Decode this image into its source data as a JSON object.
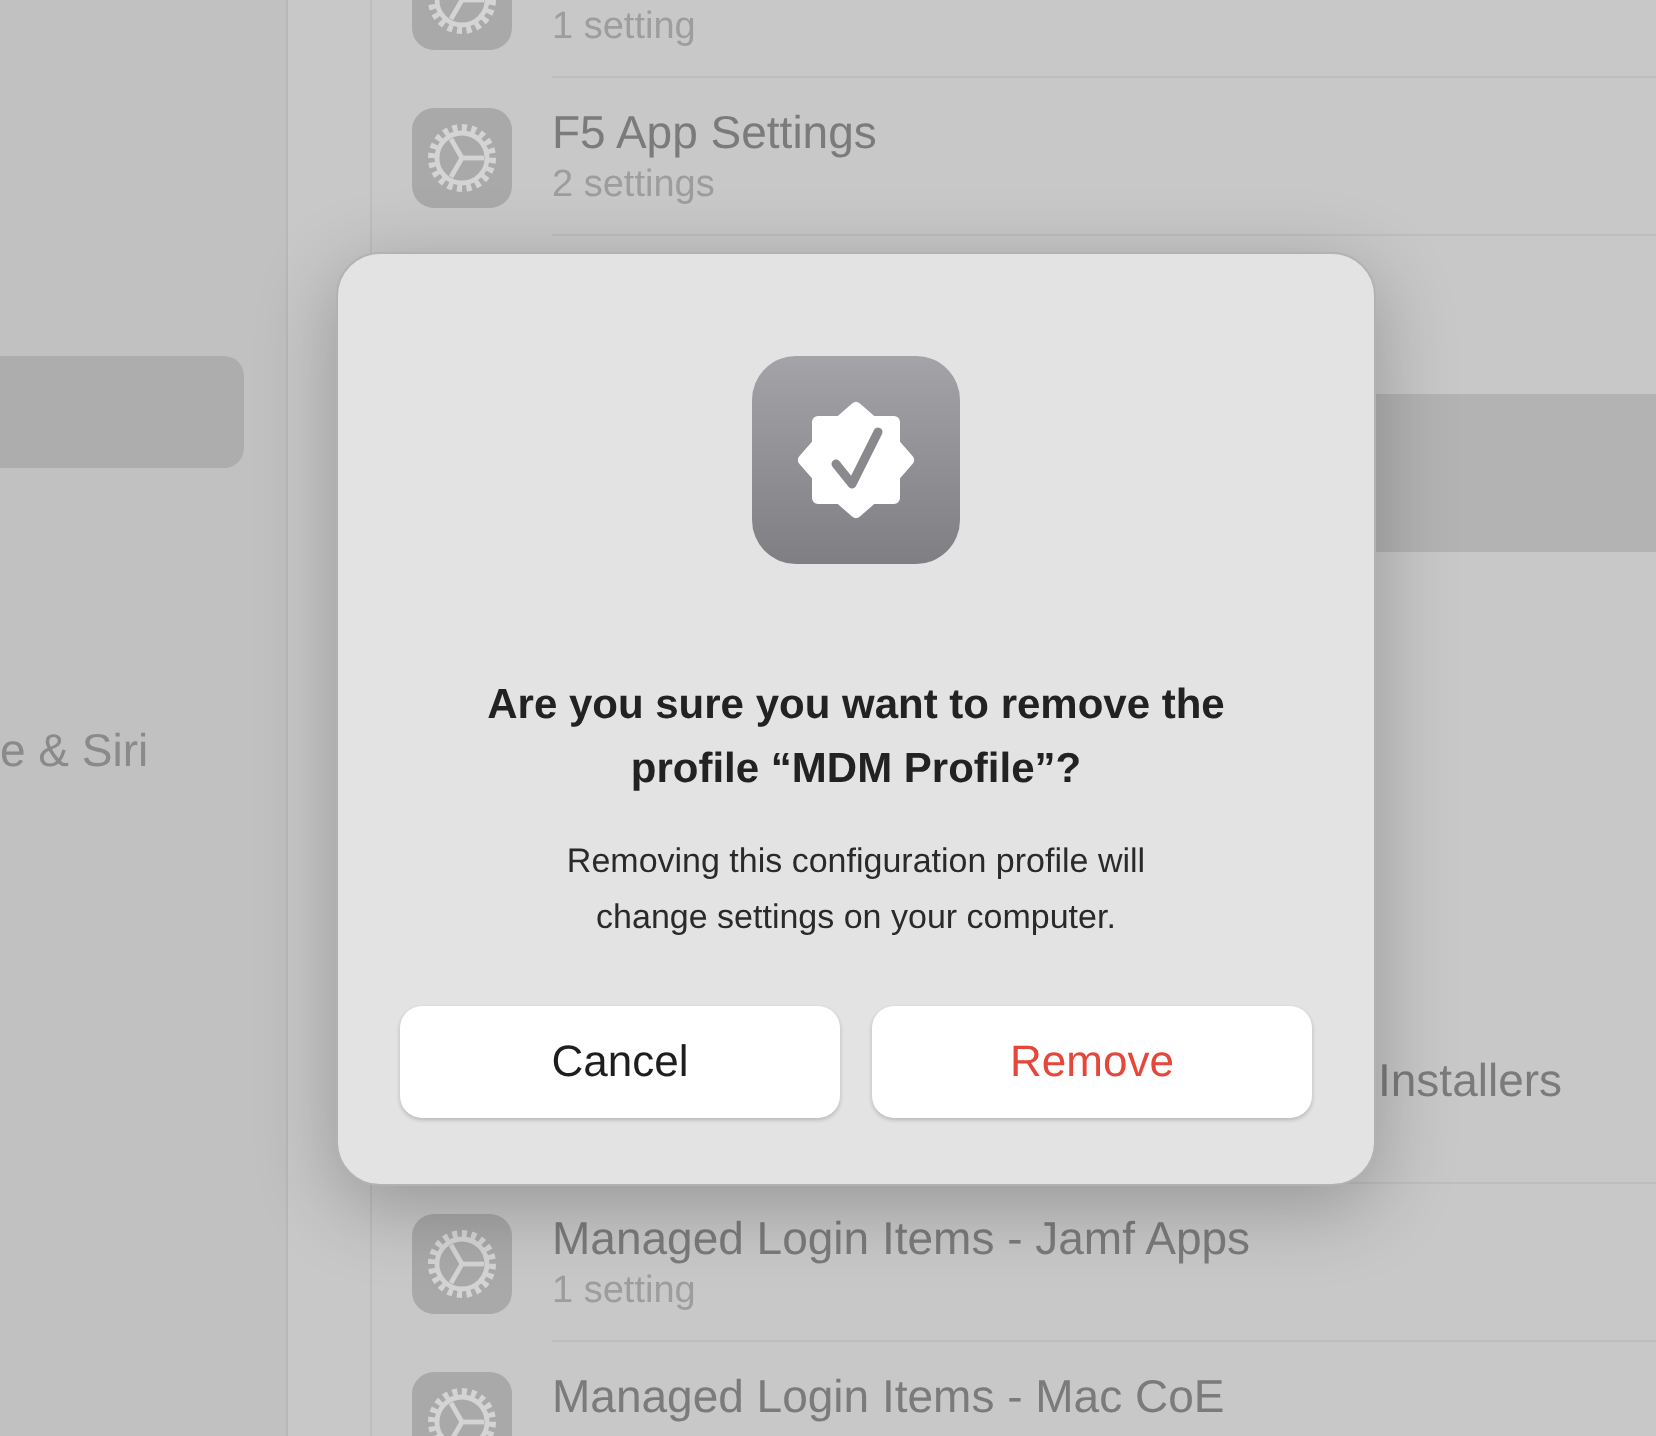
{
  "sidebar": {
    "items": [
      {
        "selected": true
      },
      {
        "label": "e & Siri",
        "selected": false
      }
    ]
  },
  "profiles": [
    {
      "subtitle": "1 setting",
      "selected": false,
      "kind": "plain"
    },
    {
      "title": "F5 App Settings",
      "subtitle": "2 settings",
      "selected": false,
      "kind": "plain"
    },
    {
      "selected": false,
      "kind": "covered"
    },
    {
      "selected": true,
      "kind": "covered"
    },
    {
      "selected": false,
      "kind": "covered"
    },
    {
      "selected": false,
      "kind": "covered"
    },
    {
      "selected": false,
      "kind": "covered"
    },
    {
      "title": "Installers",
      "selected": false,
      "kind": "partly_covered"
    },
    {
      "title": "Managed Login Items - Jamf Apps",
      "subtitle": "1 setting",
      "selected": false,
      "kind": "plain"
    },
    {
      "title": "Managed Login Items - Mac CoE",
      "selected": false,
      "kind": "plain"
    }
  ],
  "dialog": {
    "title": "Are you sure you want to remove the profile “MDM Profile”?",
    "message": "Removing this configuration profile will change settings on your computer.",
    "buttons": [
      {
        "label": "Cancel",
        "kind": "cancel"
      },
      {
        "label": "Remove",
        "kind": "destructive"
      }
    ]
  }
}
